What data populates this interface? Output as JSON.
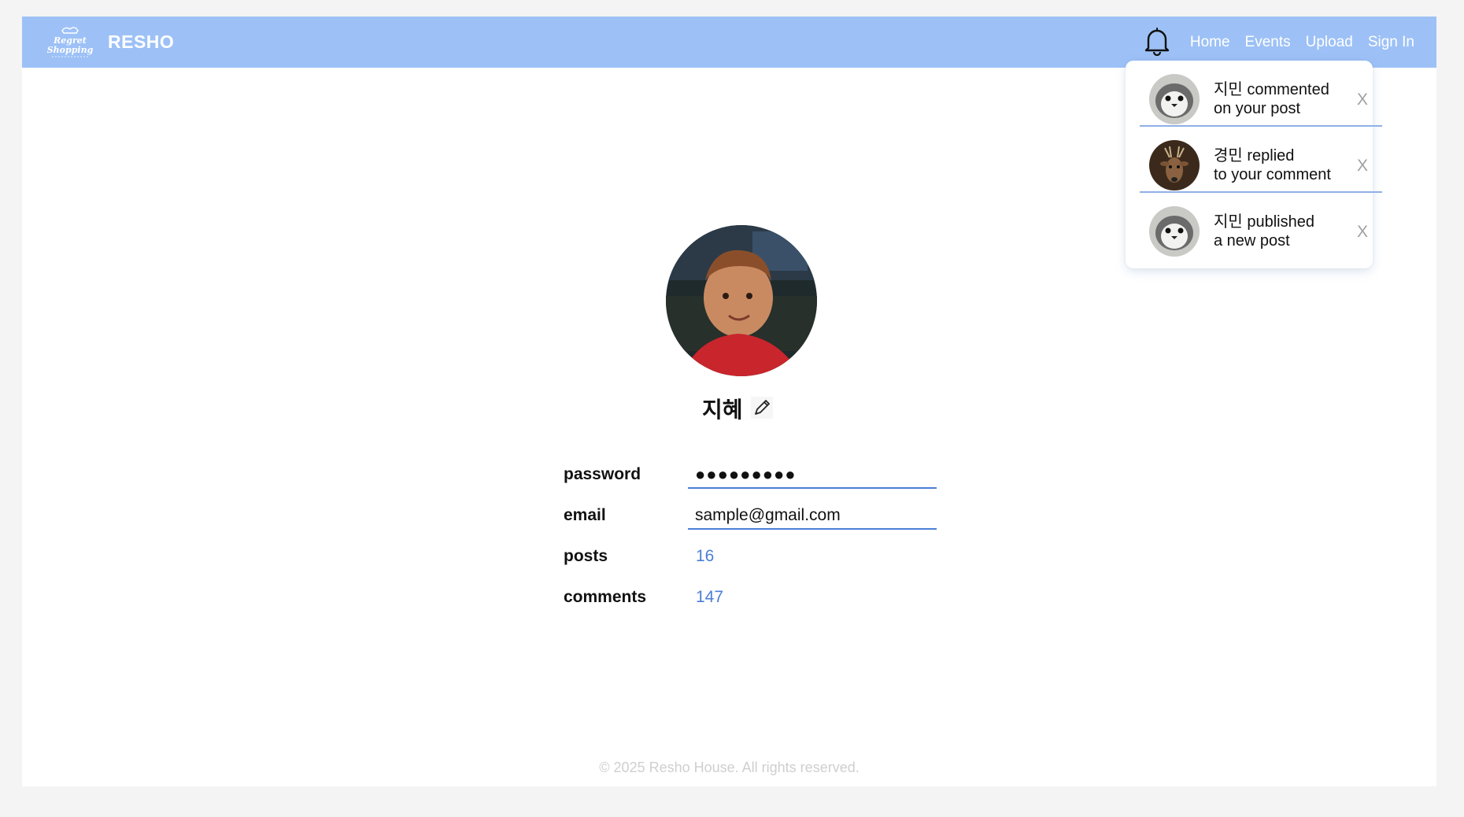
{
  "header": {
    "logo_text_line1": "Regret",
    "logo_text_line2": "Shopping",
    "brand": "RESHO",
    "nav": [
      "Home",
      "Events",
      "Upload",
      "Sign In"
    ]
  },
  "notifications": [
    {
      "line1": "지민 commented",
      "line2": "on your post",
      "avatar": "penguin-avatar",
      "close": "X"
    },
    {
      "line1": "경민 replied",
      "line2": "to your comment",
      "avatar": "deer-avatar",
      "close": "X"
    },
    {
      "line1": "지민 published",
      "line2": "a new post",
      "avatar": "penguin-avatar",
      "close": "X"
    }
  ],
  "profile": {
    "username": "지혜",
    "avatar": "child-photo",
    "fields": {
      "password_label": "password",
      "password_value": "●●●●●●●●●",
      "email_label": "email",
      "email_value": "sample@gmail.com",
      "posts_label": "posts",
      "posts_value": "16",
      "comments_label": "comments",
      "comments_value": "147"
    }
  },
  "footer": {
    "copyright": "© 2025 Resho House. All rights reserved."
  },
  "colors": {
    "header_bg": "#9dc1f6",
    "accent": "#4a7fd6",
    "footer_text": "#cfcfcf"
  }
}
